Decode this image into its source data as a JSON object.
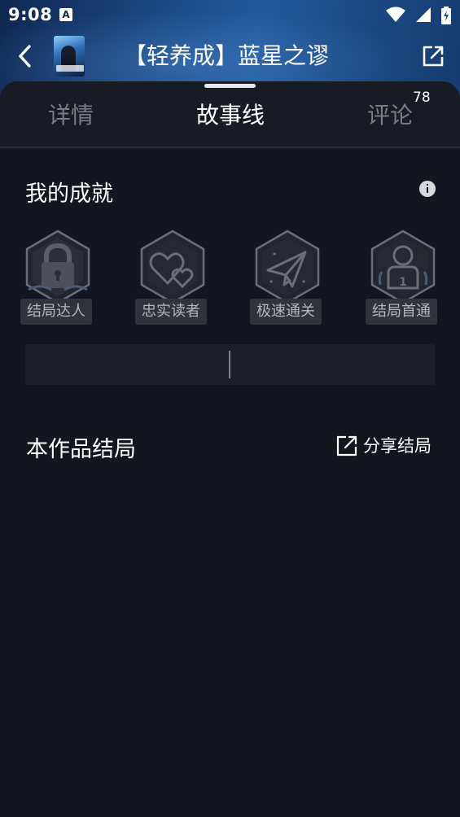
{
  "status_bar": {
    "time": "9:08",
    "notification_icon": "A",
    "icons": [
      "wifi-icon",
      "cellular-signal-icon",
      "battery-charging-icon"
    ]
  },
  "header": {
    "title": "【轻养成】蓝星之谬",
    "cover_icon": "story-cover-thumbnail",
    "back_icon": "chevron-left-icon",
    "share_icon": "external-share-icon"
  },
  "tabs": [
    {
      "label": "详情",
      "active": false
    },
    {
      "label": "故事线",
      "active": true
    },
    {
      "label": "评论",
      "badge": "78",
      "active": false
    }
  ],
  "achievements": {
    "title": "我的成就",
    "info_icon": "info-icon",
    "badges": [
      {
        "label": "结局达人",
        "icon": "padlock-icon",
        "unlocked": false
      },
      {
        "label": "忠实读者",
        "icon": "hearts-icon",
        "unlocked": false
      },
      {
        "label": "极速通关",
        "icon": "paper-plane-icon",
        "unlocked": false
      },
      {
        "label": "结局首通",
        "icon": "first-place-trophy-icon",
        "unlocked": false
      }
    ]
  },
  "endings": {
    "title": "本作品结局",
    "share_label": "分享结局",
    "share_icon": "external-share-icon"
  },
  "colors": {
    "background": "#13161e",
    "header_gradient_start": "#0f2750",
    "header_gradient_mid": "#23599c",
    "tab_active": "#ffffff",
    "tab_inactive": "#7a7d86",
    "badge_label_bg": "#30333b",
    "badge_icon_stroke": "#6a6e78"
  }
}
